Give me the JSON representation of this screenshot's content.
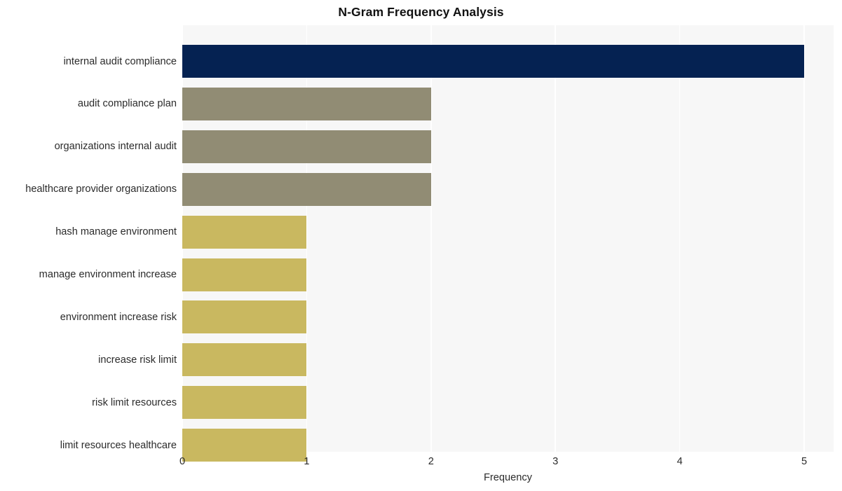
{
  "chart_data": {
    "type": "bar",
    "orientation": "horizontal",
    "title": "N-Gram Frequency Analysis",
    "xlabel": "Frequency",
    "ylabel": "",
    "categories": [
      "internal audit compliance",
      "audit compliance plan",
      "organizations internal audit",
      "healthcare provider organizations",
      "hash manage environment",
      "manage environment increase",
      "environment increase risk",
      "increase risk limit",
      "risk limit resources",
      "limit resources healthcare"
    ],
    "values": [
      5,
      2,
      2,
      2,
      1,
      1,
      1,
      1,
      1,
      1
    ],
    "bar_colors": [
      "#052252",
      "#918c74",
      "#918c74",
      "#918c74",
      "#c9b860",
      "#c9b860",
      "#c9b860",
      "#c9b860",
      "#c9b860",
      "#c9b860"
    ],
    "xlim": [
      0,
      5
    ],
    "xticks": [
      0,
      1,
      2,
      3,
      4,
      5
    ],
    "xtick_labels": [
      "0",
      "1",
      "2",
      "3",
      "4",
      "5"
    ],
    "grid": "vertical",
    "legend": "none",
    "plot_background": "#f7f7f7",
    "figure_background": "#ffffff",
    "gridline_color": "#ffffff",
    "text_color": "#2b2b2b",
    "title_color": "#111111"
  }
}
